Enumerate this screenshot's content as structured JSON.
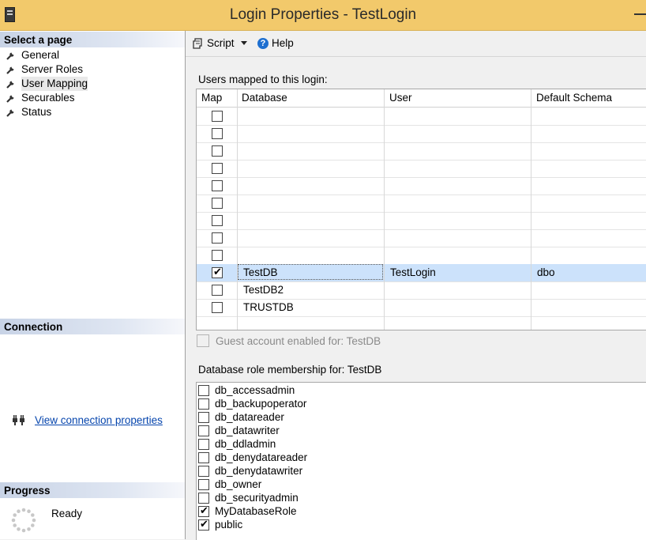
{
  "window": {
    "title": "Login Properties - TestLogin"
  },
  "left": {
    "select_page_header": "Select a page",
    "pages": [
      {
        "label": "General"
      },
      {
        "label": "Server Roles"
      },
      {
        "label": "User Mapping"
      },
      {
        "label": "Securables"
      },
      {
        "label": "Status"
      }
    ],
    "selected_page": "User Mapping",
    "connection_header": "Connection",
    "connection_link": "View connection properties",
    "progress_header": "Progress",
    "progress_status": "Ready"
  },
  "toolbar": {
    "script_label": "Script",
    "help_label": "Help"
  },
  "mapping": {
    "label": "Users mapped to this login:",
    "columns": [
      "Map",
      "Database",
      "User",
      "Default Schema"
    ],
    "rows": [
      {
        "map": false,
        "database": "",
        "user": "",
        "schema": ""
      },
      {
        "map": false,
        "database": "",
        "user": "",
        "schema": ""
      },
      {
        "map": false,
        "database": "",
        "user": "",
        "schema": ""
      },
      {
        "map": false,
        "database": "",
        "user": "",
        "schema": ""
      },
      {
        "map": false,
        "database": "",
        "user": "",
        "schema": ""
      },
      {
        "map": false,
        "database": "",
        "user": "",
        "schema": ""
      },
      {
        "map": false,
        "database": "",
        "user": "",
        "schema": ""
      },
      {
        "map": false,
        "database": "",
        "user": "",
        "schema": ""
      },
      {
        "map": false,
        "database": "",
        "user": "",
        "schema": ""
      },
      {
        "map": true,
        "database": "TestDB",
        "user": "TestLogin",
        "schema": "dbo",
        "selected": true
      },
      {
        "map": false,
        "database": "TestDB2",
        "user": "",
        "schema": ""
      },
      {
        "map": false,
        "database": "TRUSTDB",
        "user": "",
        "schema": ""
      }
    ]
  },
  "guest": {
    "label": "Guest account enabled for: TestDB",
    "checked": false,
    "enabled": false
  },
  "roles": {
    "label": "Database role membership for: TestDB",
    "items": [
      {
        "name": "db_accessadmin",
        "checked": false
      },
      {
        "name": "db_backupoperator",
        "checked": false
      },
      {
        "name": "db_datareader",
        "checked": false
      },
      {
        "name": "db_datawriter",
        "checked": false
      },
      {
        "name": "db_ddladmin",
        "checked": false
      },
      {
        "name": "db_denydatareader",
        "checked": false
      },
      {
        "name": "db_denydatawriter",
        "checked": false
      },
      {
        "name": "db_owner",
        "checked": false
      },
      {
        "name": "db_securityadmin",
        "checked": false
      },
      {
        "name": "MyDatabaseRole",
        "checked": true
      },
      {
        "name": "public",
        "checked": true
      }
    ]
  },
  "colors": {
    "titlebar": "#f2c96b",
    "selected_row": "#cce2fb",
    "section_header": "#c8d3e6",
    "link": "#0645ad"
  }
}
